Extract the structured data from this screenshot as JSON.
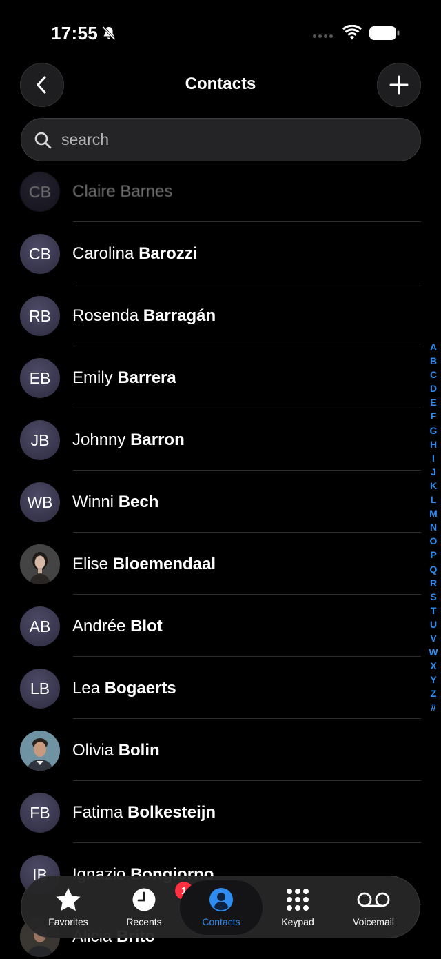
{
  "status_bar": {
    "time": "17:55"
  },
  "header": {
    "title": "Contacts"
  },
  "search": {
    "placeholder": "search"
  },
  "contacts": [
    {
      "initials": "CB",
      "first": "Claire",
      "last": "Barnes"
    },
    {
      "initials": "CB",
      "first": "Carolina",
      "last": "Barozzi"
    },
    {
      "initials": "RB",
      "first": "Rosenda",
      "last": "Barragán"
    },
    {
      "initials": "EB",
      "first": "Emily",
      "last": "Barrera"
    },
    {
      "initials": "JB",
      "first": "Johnny",
      "last": "Barron"
    },
    {
      "initials": "WB",
      "first": "Winni",
      "last": "Bech"
    },
    {
      "initials": "",
      "first": "Elise",
      "last": "Bloemendaal",
      "photo": "woman-portrait"
    },
    {
      "initials": "AB",
      "first": "Andrée",
      "last": "Blot"
    },
    {
      "initials": "LB",
      "first": "Lea",
      "last": "Bogaerts"
    },
    {
      "initials": "",
      "first": "Olivia",
      "last": "Bolin",
      "photo": "man-portrait"
    },
    {
      "initials": "FB",
      "first": "Fatima",
      "last": "Bolkesteijn"
    },
    {
      "initials": "IB",
      "first": "Ignazio",
      "last": "Bongiorno"
    },
    {
      "initials": "",
      "first": "Alicia",
      "last": "Brito",
      "photo": "man-portrait"
    }
  ],
  "index_letters": [
    "A",
    "B",
    "C",
    "D",
    "E",
    "F",
    "G",
    "H",
    "I",
    "J",
    "K",
    "L",
    "M",
    "N",
    "O",
    "P",
    "Q",
    "R",
    "S",
    "T",
    "U",
    "V",
    "W",
    "X",
    "Y",
    "Z",
    "#"
  ],
  "tabs": [
    {
      "label": "Favorites",
      "icon": "star-icon"
    },
    {
      "label": "Recents",
      "icon": "clock-icon",
      "badge": "1"
    },
    {
      "label": "Contacts",
      "icon": "person-circle-icon",
      "active": true
    },
    {
      "label": "Keypad",
      "icon": "keypad-icon"
    },
    {
      "label": "Voicemail",
      "icon": "voicemail-icon"
    }
  ],
  "colors": {
    "accent": "#2f8cf0",
    "badge": "#ff3040",
    "background": "#000000",
    "avatar": "#3a3852"
  }
}
